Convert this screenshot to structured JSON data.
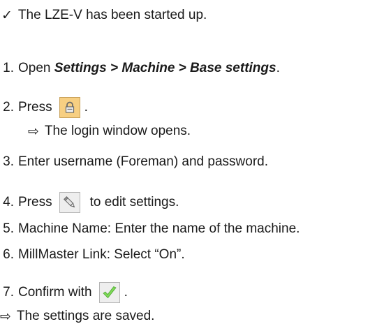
{
  "prerequisite": {
    "symbol": "✓",
    "text": "The LZE-V has been started up."
  },
  "steps": [
    {
      "num": "1.",
      "text_before": "Open ",
      "emphasis": "Settings > Machine > Base settings",
      "text_after": "."
    },
    {
      "num": "2.",
      "text_before": "Press",
      "icon": "lock-icon",
      "text_after": "."
    },
    {
      "result_symbol": "⇨",
      "result_text": "The login window opens."
    },
    {
      "num": "3.",
      "text": "Enter username (Foreman) and password."
    },
    {
      "num": "4.",
      "text_before": "Press",
      "icon": "pencil-icon",
      "text_after": "to edit settings."
    },
    {
      "num": "5.",
      "text": "Machine Name: Enter the name of the machine."
    },
    {
      "num": "6.",
      "text": "MillMaster Link: Select “On”."
    },
    {
      "num": "7.",
      "text_before": "Confirm with",
      "icon": "checkmark-icon",
      "text_after": "."
    }
  ],
  "final_result": {
    "symbol": "⇨",
    "text": "The settings are saved."
  },
  "colors": {
    "lock_button": "#f7cf82",
    "check_green": "#7ed957"
  }
}
